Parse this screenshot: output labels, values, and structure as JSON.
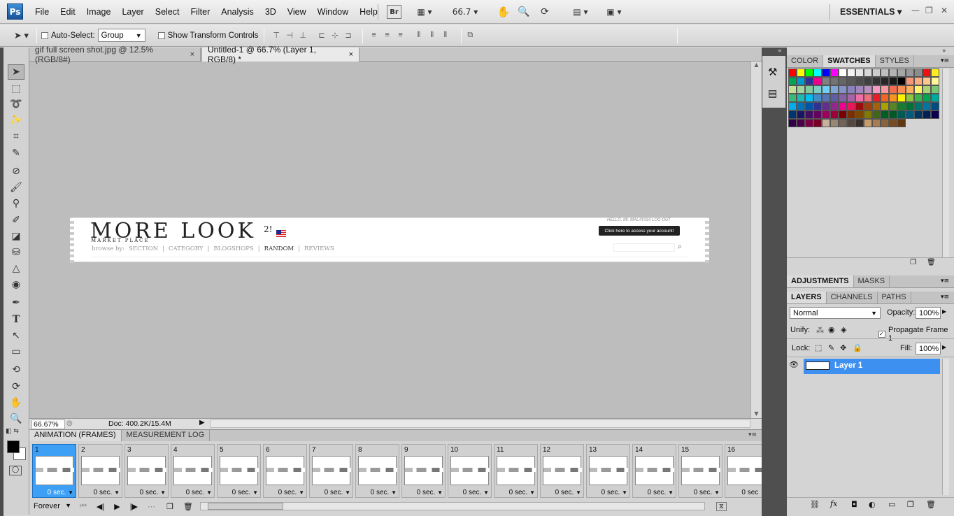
{
  "app": {
    "logo": "Ps",
    "workspace": "ESSENTIALS"
  },
  "menus": [
    "File",
    "Edit",
    "Image",
    "Layer",
    "Select",
    "Filter",
    "Analysis",
    "3D",
    "View",
    "Window",
    "Help"
  ],
  "menubar_extras": {
    "bridge": "Br",
    "zoom": "66.7"
  },
  "options": {
    "auto_select_label": "Auto-Select:",
    "auto_select_value": "Group",
    "show_transform_label": "Show Transform Controls"
  },
  "tabs": [
    {
      "label": "gif full screen shot.jpg @ 12.5% (RGB/8#)",
      "close": "×"
    },
    {
      "label": "Untitled-1 @ 66.7% (Layer 1, RGB/8) *",
      "close": "×"
    }
  ],
  "canvas": {
    "title": "MORE LOOK",
    "superscript": "2!",
    "subtitle": "MARKET PLACE",
    "nav_prefix": "browse by:",
    "nav": [
      "SECTION",
      "CATEGORY",
      "BLOGSHOPS",
      "RANDOM",
      "REVIEWS"
    ],
    "greeting": "HELLO, MI. MALAYSIA  LOG OUT",
    "tooltip": "Click here to access your account!"
  },
  "status": {
    "zoom": "66.67%",
    "doc": "Doc: 400.2K/15.4M"
  },
  "animation": {
    "tabs": [
      "ANIMATION (FRAMES)",
      "MEASUREMENT LOG"
    ],
    "frames": [
      {
        "n": "1",
        "delay": "0 sec."
      },
      {
        "n": "2",
        "delay": "0 sec."
      },
      {
        "n": "3",
        "delay": "0 sec."
      },
      {
        "n": "4",
        "delay": "0 sec."
      },
      {
        "n": "5",
        "delay": "0 sec."
      },
      {
        "n": "6",
        "delay": "0 sec."
      },
      {
        "n": "7",
        "delay": "0 sec."
      },
      {
        "n": "8",
        "delay": "0 sec."
      },
      {
        "n": "9",
        "delay": "0 sec."
      },
      {
        "n": "10",
        "delay": "0 sec."
      },
      {
        "n": "11",
        "delay": "0 sec."
      },
      {
        "n": "12",
        "delay": "0 sec."
      },
      {
        "n": "13",
        "delay": "0 sec."
      },
      {
        "n": "14",
        "delay": "0 sec."
      },
      {
        "n": "15",
        "delay": "0 sec."
      },
      {
        "n": "16",
        "delay": "0 sec"
      }
    ],
    "loop": "Forever"
  },
  "right": {
    "color_tabs": [
      "COLOR",
      "SWATCHES",
      "STYLES"
    ],
    "adj_tabs": [
      "ADJUSTMENTS",
      "MASKS"
    ],
    "layer_tabs": [
      "LAYERS",
      "CHANNELS",
      "PATHS"
    ],
    "blend_mode": "Normal",
    "opacity_label": "Opacity:",
    "opacity": "100%",
    "unify_label": "Unify:",
    "propagate_label": "Propagate Frame 1",
    "lock_label": "Lock:",
    "fill_label": "Fill:",
    "fill": "100%",
    "layer_name": "Layer 1"
  },
  "colors": {
    "accent": "#3d8ff0",
    "selected_frame": "#3da0f5"
  },
  "swatches": [
    "#ff0000",
    "#ffff00",
    "#00ff00",
    "#00ffff",
    "#0000ff",
    "#ff00ff",
    "#ffffff",
    "#f2f2f2",
    "#e6e6e6",
    "#d9d9d9",
    "#cccccc",
    "#bfbfbf",
    "#b3b3b3",
    "#a6a6a6",
    "#999999",
    "#8c8c8c",
    "#ee1111",
    "#ffee22",
    "#00a651",
    "#0099cc",
    "#2e3192",
    "#ec008c",
    "#808080",
    "#737373",
    "#666666",
    "#595959",
    "#4d4d4d",
    "#404040",
    "#333333",
    "#262626",
    "#1a1a1a",
    "#000000",
    "#f7977a",
    "#f9ad81",
    "#fdc68a",
    "#fff79a",
    "#c4df9b",
    "#a3d39c",
    "#82ca9d",
    "#7bcdc8",
    "#6ecff6",
    "#7ea7d8",
    "#8493ca",
    "#8882be",
    "#a187be",
    "#bc8dbf",
    "#f49ac2",
    "#f6989d",
    "#f26c4f",
    "#f68e55",
    "#fbaf5c",
    "#fff467",
    "#acd372",
    "#7cc576",
    "#3bb878",
    "#1abbb4",
    "#00bff3",
    "#438cca",
    "#5574b9",
    "#605ca8",
    "#855fa8",
    "#a763a8",
    "#f06ea9",
    "#f26d7d",
    "#ed1c24",
    "#f26522",
    "#f7941d",
    "#fff200",
    "#8dc73f",
    "#39b54a",
    "#00a651",
    "#00a99d",
    "#00aeef",
    "#0072bc",
    "#0054a6",
    "#2e3192",
    "#662d91",
    "#92278f",
    "#ec008c",
    "#ed145b",
    "#9e0b0f",
    "#a0410d",
    "#a36209",
    "#aba000",
    "#598527",
    "#197b30",
    "#007236",
    "#00746b",
    "#0076a3",
    "#004b80",
    "#003471",
    "#1b1464",
    "#440e62",
    "#630460",
    "#9e005d",
    "#9e0039",
    "#790000",
    "#7b2e00",
    "#7d4900",
    "#827b00",
    "#406618",
    "#005e20",
    "#005826",
    "#005952",
    "#005b7f",
    "#003663",
    "#002157",
    "#0d004c",
    "#32004b",
    "#4b0049",
    "#7b0046",
    "#7a0026",
    "#c7b299",
    "#998675",
    "#736357",
    "#534741",
    "#37302d",
    "#c69c6d",
    "#a67c52",
    "#8c6239",
    "#754c24",
    "#603913"
  ]
}
